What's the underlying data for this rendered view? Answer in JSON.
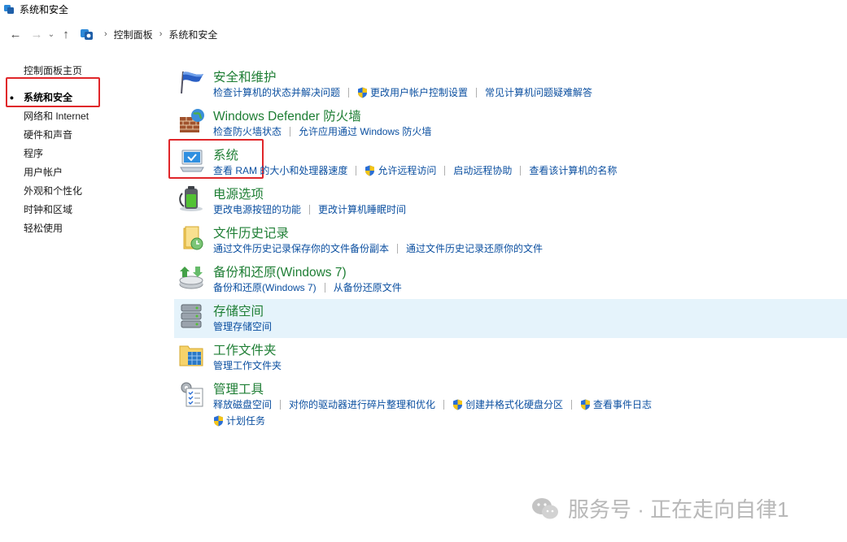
{
  "window": {
    "title": "系统和安全"
  },
  "nav": {
    "back": "←",
    "forward": "→",
    "recent": "⌄",
    "up": "↑"
  },
  "breadcrumb": {
    "sep1": "›",
    "root": "控制面板",
    "sep2": "›",
    "current": "系统和安全"
  },
  "sidebar": {
    "home": "控制面板主页",
    "items": [
      {
        "label": "系统和安全",
        "active": true
      },
      {
        "label": "网络和 Internet"
      },
      {
        "label": "硬件和声音"
      },
      {
        "label": "程序"
      },
      {
        "label": "用户帐户"
      },
      {
        "label": "外观和个性化"
      },
      {
        "label": "时钟和区域"
      },
      {
        "label": "轻松使用"
      }
    ]
  },
  "categories": [
    {
      "id": "security-maintenance",
      "title": "安全和维护",
      "icon": "flag-icon",
      "links": [
        {
          "label": "检查计算机的状态并解决问题"
        },
        {
          "label": "更改用户帐户控制设置",
          "shield": true
        },
        {
          "label": "常见计算机问题疑难解答"
        }
      ]
    },
    {
      "id": "firewall",
      "title": "Windows Defender 防火墙",
      "icon": "firewall-icon",
      "links": [
        {
          "label": "检查防火墙状态"
        },
        {
          "label": "允许应用通过 Windows 防火墙"
        }
      ]
    },
    {
      "id": "system",
      "title": "系统",
      "icon": "computer-icon",
      "links": [
        {
          "label": "查看 RAM 的大小和处理器速度"
        },
        {
          "label": "允许远程访问",
          "shield": true
        },
        {
          "label": "启动远程协助"
        },
        {
          "label": "查看该计算机的名称"
        }
      ]
    },
    {
      "id": "power",
      "title": "电源选项",
      "icon": "battery-icon",
      "links": [
        {
          "label": "更改电源按钮的功能"
        },
        {
          "label": "更改计算机睡眠时间"
        }
      ]
    },
    {
      "id": "file-history",
      "title": "文件历史记录",
      "icon": "folder-clock-icon",
      "links": [
        {
          "label": "通过文件历史记录保存你的文件备份副本"
        },
        {
          "label": "通过文件历史记录还原你的文件"
        }
      ]
    },
    {
      "id": "backup",
      "title": "备份和还原(Windows 7)",
      "icon": "backup-icon",
      "links": [
        {
          "label": "备份和还原(Windows 7)"
        },
        {
          "label": "从备份还原文件"
        }
      ]
    },
    {
      "id": "storage-spaces",
      "title": "存储空间",
      "icon": "storage-icon",
      "highlight": true,
      "links": [
        {
          "label": "管理存储空间"
        }
      ]
    },
    {
      "id": "work-folders",
      "title": "工作文件夹",
      "icon": "work-folder-icon",
      "links": [
        {
          "label": "管理工作文件夹"
        }
      ]
    },
    {
      "id": "admin-tools",
      "title": "管理工具",
      "icon": "admin-tools-icon",
      "links": [
        {
          "label": "释放磁盘空间"
        },
        {
          "label": "对你的驱动器进行碎片整理和优化"
        },
        {
          "label": "创建并格式化硬盘分区",
          "shield": true
        },
        {
          "label": "查看事件日志",
          "shield": true
        }
      ],
      "links2": [
        {
          "label": "计划任务",
          "shield": true
        }
      ]
    }
  ],
  "watermark": {
    "text": "服务号 · 正在走向自律1"
  },
  "colors": {
    "category_title": "#1e7e34",
    "link": "#0b4fa0",
    "highlight_row": "#e5f3fb",
    "annotation_box": "#e0262a"
  }
}
